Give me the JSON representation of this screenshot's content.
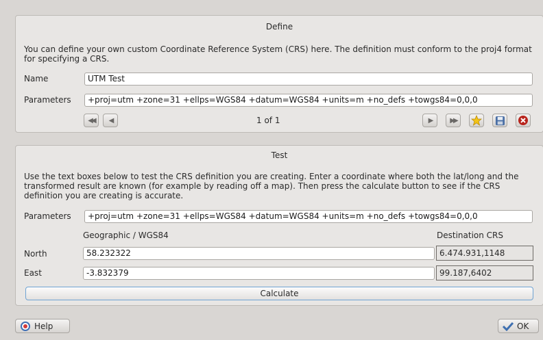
{
  "define": {
    "title": "Define",
    "description": "You can define your own custom Coordinate Reference System (CRS) here. The definition must conform to the proj4 format for specifying a CRS.",
    "name_label": "Name",
    "name_value": "UTM Test",
    "parameters_label": "Parameters",
    "parameters_value": "+proj=utm +zone=31 +ellps=WGS84 +datum=WGS84 +units=m +no_defs +towgs84=0,0,0",
    "record_counter": "1 of 1"
  },
  "test": {
    "title": "Test",
    "description": "Use the text boxes below to test the CRS definition you are creating. Enter a coordinate where both the lat/long and the transformed result are known (for example by reading off a map). Then press the calculate button to see if the CRS definition you are creating is accurate.",
    "parameters_label": "Parameters",
    "parameters_value": "+proj=utm +zone=31 +ellps=WGS84 +datum=WGS84 +units=m +no_defs +towgs84=0,0,0",
    "geographic_header": "Geographic / WGS84",
    "destination_header": "Destination CRS",
    "north_label": "North",
    "north_value": "58.232322",
    "north_result": "6.474.931,1148",
    "east_label": "East",
    "east_value": "-3.832379",
    "east_result": "99.187,6402",
    "calculate_label": "Calculate"
  },
  "footer": {
    "help_label": "Help",
    "ok_label": "OK"
  },
  "colors": {
    "accent_border": "#6fa3d3",
    "star": "#f3c417",
    "close": "#b8241c",
    "ok_check": "#3e6fb0"
  }
}
